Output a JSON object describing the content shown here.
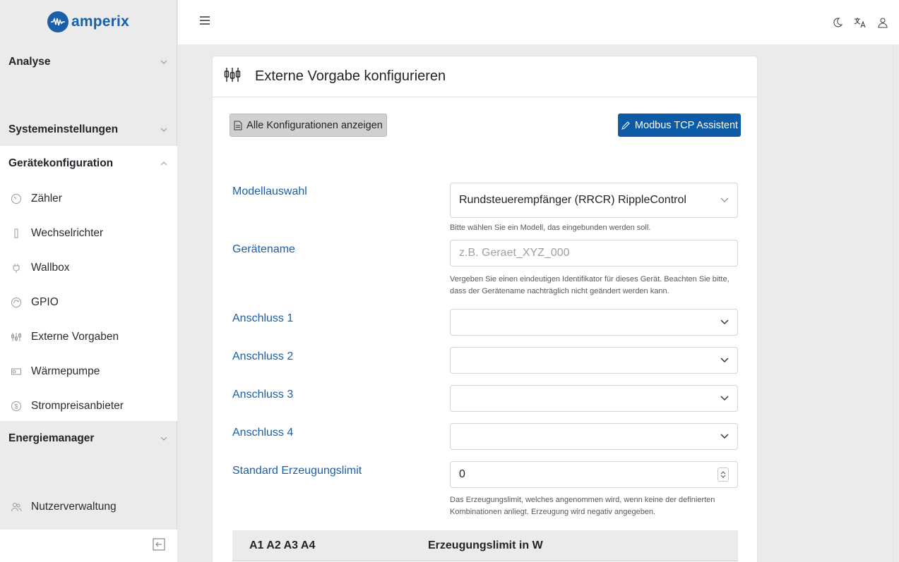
{
  "brand": {
    "name": "amperix"
  },
  "sidebar": {
    "sections": {
      "analyse": "Analyse",
      "system": "Systemeinstellungen",
      "geraete": "Gerätekonfiguration",
      "energie": "Energiemanager"
    },
    "items": [
      {
        "label": "Zähler",
        "icon": "gauge-icon"
      },
      {
        "label": "Wechselrichter",
        "icon": "inverter-icon"
      },
      {
        "label": "Wallbox",
        "icon": "plug-icon"
      },
      {
        "label": "GPIO",
        "icon": "cycle-icon"
      },
      {
        "label": "Externe Vorgaben",
        "icon": "sliders-icon"
      },
      {
        "label": "Wärmepumpe",
        "icon": "heatpump-icon"
      },
      {
        "label": "Strompreisanbieter",
        "icon": "dollar-icon"
      }
    ],
    "nutzer": "Nutzerverwaltung"
  },
  "card": {
    "title": "Externe Vorgabe konfigurieren",
    "btn_all": "Alle Konfigurationen anzeigen",
    "btn_modbus": "Modbus TCP Assistent"
  },
  "form": {
    "model_label": "Modellauswahl",
    "model_value": "Rundsteuerempfänger (RRCR) RippleControl",
    "model_help": "Bitte wählen Sie ein Modell, das eingebunden werden soll.",
    "name_label": "Gerätename",
    "name_placeholder": "z.B. Geraet_XYZ_000",
    "name_help": "Vergeben Sie einen eindeutigen Identifikator für dieses Gerät. Beachten Sie bitte, dass der Gerätename nachträglich nicht geändert werden kann.",
    "a1": "Anschluss 1",
    "a2": "Anschluss 2",
    "a3": "Anschluss 3",
    "a4": "Anschluss 4",
    "limit_label": "Standard Erzeugungslimit",
    "limit_value": "0",
    "limit_help": "Das Erzeugungslimit, welches angenommen wird, wenn keine der definierten Kombinationen anliegt. Erzeugung wird negativ angegeben."
  },
  "table": {
    "col1": "A1 A2 A3 A4",
    "col2": "Erzeugungslimit in W"
  }
}
